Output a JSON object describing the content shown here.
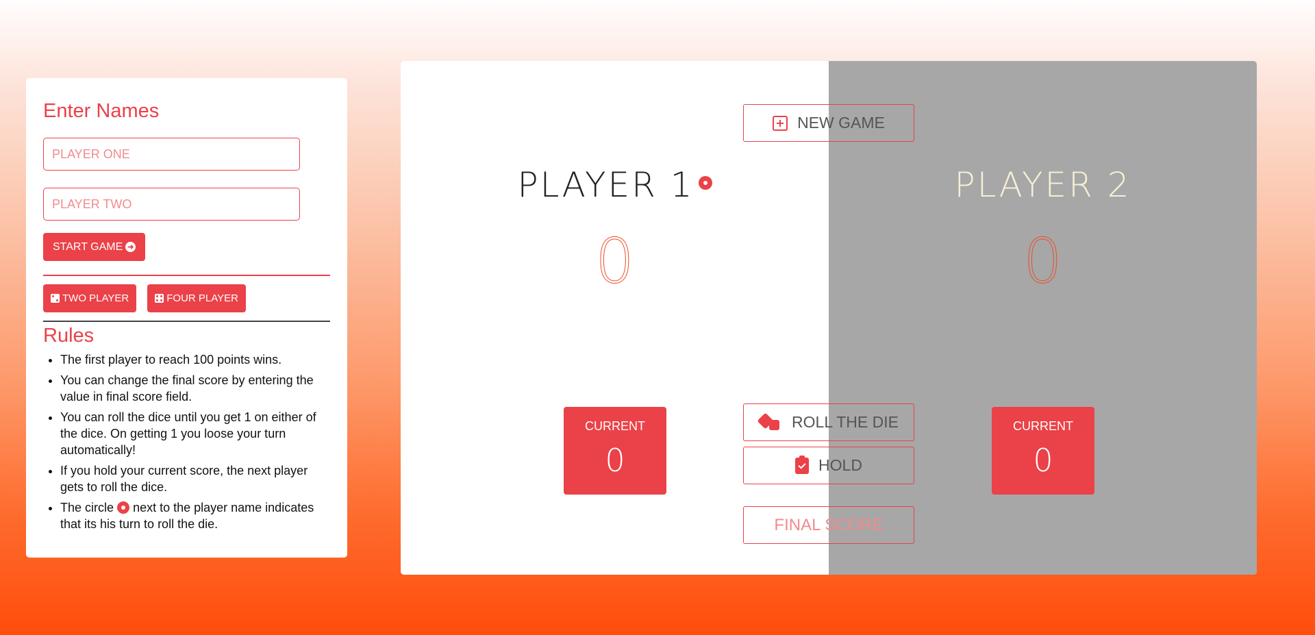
{
  "setup": {
    "title": "Enter Names",
    "player_one_placeholder": "PLAYER ONE",
    "player_two_placeholder": "PLAYER TWO",
    "start_label": "START GAME",
    "two_player_label": "TWO PLAYER",
    "four_player_label": "FOUR PLAYER"
  },
  "rules": {
    "title": "Rules",
    "items": [
      "The first player to reach 100 points wins.",
      "You can change the final score by entering the value in final score field.",
      "You can roll the dice until you get 1 on either of the dice. On getting 1 you loose your turn automatically!",
      "If you hold your current score, the next player gets to roll the dice."
    ],
    "last_item_before": "The circle",
    "last_item_after": "next to the player name indicates that its his turn to roll the die."
  },
  "game": {
    "new_game_label": "NEW GAME",
    "roll_label": "ROLL THE DIE",
    "hold_label": "HOLD",
    "final_score_placeholder": "FINAL SCORE",
    "players": [
      {
        "name": "PLAYER 1",
        "score": "0",
        "current_label": "CURRENT",
        "current_value": "0",
        "active": true
      },
      {
        "name": "PLAYER 2",
        "score": "0",
        "current_label": "CURRENT",
        "current_value": "0",
        "active": false
      }
    ]
  },
  "colors": {
    "accent": "#eb4148",
    "inactive_panel": "#a7a7a7",
    "active_panel": "#ffffff"
  }
}
